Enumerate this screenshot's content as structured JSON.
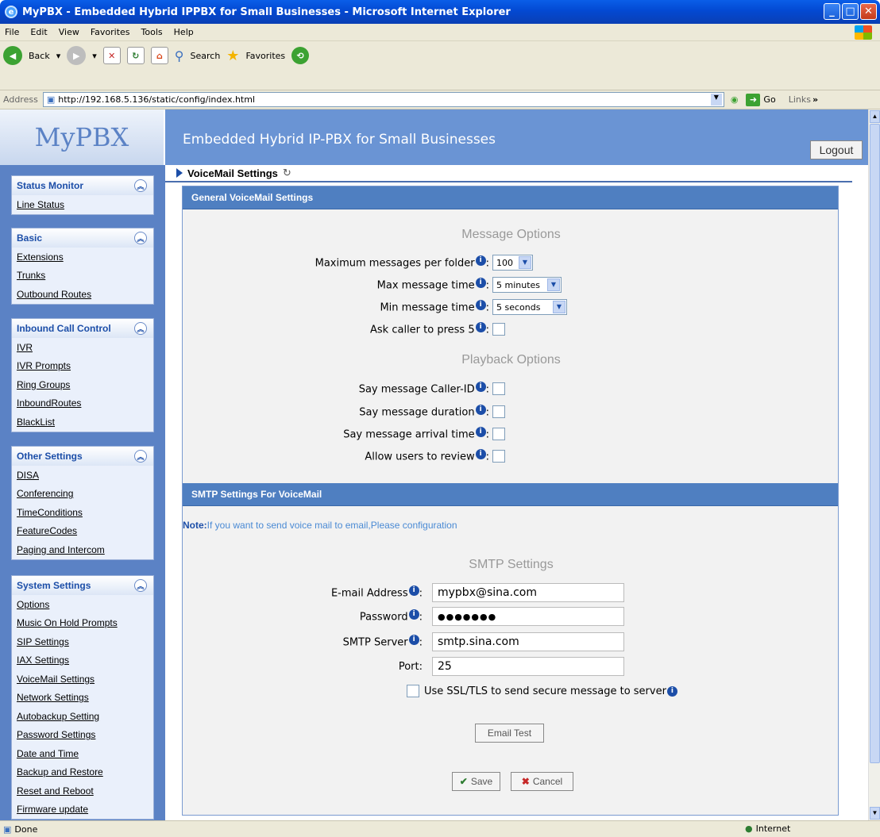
{
  "window": {
    "title": "MyPBX - Embedded Hybrid IPPBX for Small Businesses - Microsoft Internet Explorer"
  },
  "menu": [
    "File",
    "Edit",
    "View",
    "Favorites",
    "Tools",
    "Help"
  ],
  "toolbar": {
    "back": "Back",
    "search": "Search",
    "favorites": "Favorites"
  },
  "address": {
    "label": "Address",
    "url": "http://192.168.5.136/static/config/index.html",
    "go": "Go",
    "links": "Links"
  },
  "header": {
    "logo": "MyPBX",
    "tagline": "Embedded Hybrid IP-PBX for Small Businesses",
    "logout": "Logout"
  },
  "sidebar": [
    {
      "title": "Status Monitor",
      "items": [
        "Line Status"
      ]
    },
    {
      "title": "Basic",
      "items": [
        "Extensions",
        "Trunks",
        "Outbound Routes"
      ]
    },
    {
      "title": "Inbound Call Control",
      "items": [
        "IVR",
        "IVR Prompts",
        "Ring Groups",
        "InboundRoutes",
        "BlackList"
      ]
    },
    {
      "title": "Other Settings",
      "items": [
        "DISA",
        "Conferencing",
        "TimeConditions",
        "FeatureCodes",
        "Paging and Intercom"
      ]
    },
    {
      "title": "System Settings",
      "items": [
        "Options",
        "Music On Hold Prompts",
        "SIP Settings",
        "IAX Settings",
        "VoiceMail Settings",
        "Network Settings",
        "Autobackup Setting",
        "Password Settings",
        "Date and Time",
        "Backup and Restore",
        "Reset and Reboot",
        "Firmware update"
      ]
    }
  ],
  "breadcrumb": {
    "title": "VoiceMail Settings"
  },
  "general": {
    "heading": "General VoiceMail Settings",
    "message_options": "Message Options",
    "max_messages_label": "Maximum messages per folder",
    "max_messages_value": "100",
    "max_time_label": "Max message time",
    "max_time_value": "5 minutes",
    "min_time_label": "Min message time",
    "min_time_value": "5 seconds",
    "press5_label": "Ask caller to press 5",
    "playback_options": "Playback Options",
    "say_callerid_label": "Say message Caller-ID",
    "say_duration_label": "Say message duration",
    "say_arrival_label": "Say message arrival time",
    "allow_review_label": "Allow users to review"
  },
  "smtp": {
    "heading": "SMTP Settings For VoiceMail",
    "note_prefix": "Note:",
    "note_text": "If you want to send voice mail to email,Please configuration",
    "subtitle": "SMTP Settings",
    "email_label": "E-mail Address",
    "email_value": "mypbx@sina.com",
    "password_label": "Password",
    "password_value": "●●●●●●●",
    "server_label": "SMTP Server",
    "server_value": "smtp.sina.com",
    "port_label": "Port",
    "port_value": "25",
    "ssl_label": "Use SSL/TLS to send secure message to server",
    "email_test": "Email Test",
    "save": "Save",
    "cancel": "Cancel"
  },
  "status": {
    "left": "Done",
    "zone": "Internet"
  }
}
